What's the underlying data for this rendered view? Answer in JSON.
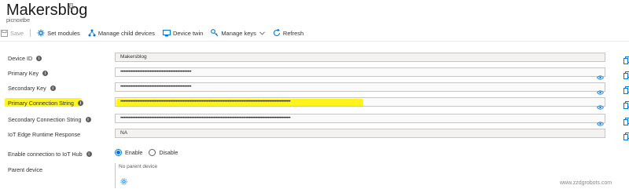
{
  "header": {
    "title": "Makersblog",
    "subtitle": "picnoxtbe"
  },
  "toolbar": {
    "save": "Save",
    "set_modules": "Set modules",
    "manage_child": "Manage child devices",
    "device_twin": "Device twin",
    "manage_keys": "Manage keys",
    "refresh": "Refresh"
  },
  "fields": {
    "device_id": {
      "label": "Device ID",
      "value": "Makersblog"
    },
    "primary_key": {
      "label": "Primary Key",
      "value": "••••••••••••••••••••••••••••••••••••••••••••••••••••••••••••"
    },
    "secondary_key": {
      "label": "Secondary Key",
      "value": "••••••••••••••••••••••••••••••••••••••••••••••••••••••••••••"
    },
    "primary_conn": {
      "label": "Primary Connection String",
      "value": "••••••••••••••••••••••••••••••••••••••••••••••••••••••••••••••••••••••••••••••••••••••••••••••••••••••••••••••••••••••••••••••••••••••••••••••••"
    },
    "secondary_conn": {
      "label": "Secondary Connection String",
      "value": "••••••••••••••••••••••••••••••••••••••••••••••••••••••••••••••••••••••••••••••••••••••••••••••••••••••••••••••••••••••••••••••••••••••••••••••••"
    },
    "iot_edge": {
      "label": "IoT Edge Runtime Response",
      "value": "NA"
    },
    "enable_conn": {
      "label": "Enable connection to IoT Hub",
      "enable": "Enable",
      "disable": "Disable",
      "selected": "Enable"
    },
    "parent": {
      "label": "Parent device",
      "value": "No parent device"
    }
  },
  "watermark": "www.zzdgrobots.com",
  "colors": {
    "accent": "#0078d4",
    "highlight": "#fff200"
  },
  "icons": [
    "pin-icon",
    "save-icon",
    "set-modules-icon",
    "manage-child-icon",
    "device-twin-icon",
    "manage-keys-icon",
    "refresh-icon",
    "info-icon",
    "eye-icon",
    "copy-icon",
    "gear-icon"
  ]
}
